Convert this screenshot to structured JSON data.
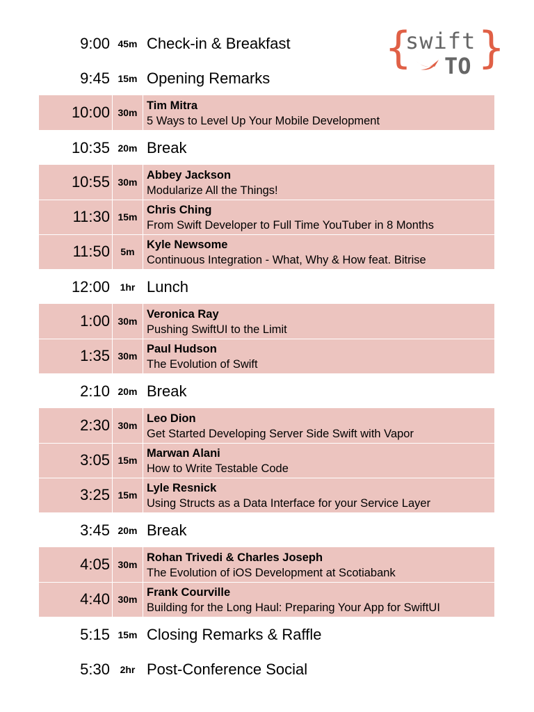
{
  "logo": {
    "word": "swift",
    "suffix": "TO",
    "accent_color": "#e06046",
    "icon": "swift-bird-icon"
  },
  "schedule": [
    {
      "time": "9:00",
      "duration": "45m",
      "event": "Check-in & Breakfast"
    },
    {
      "time": "9:45",
      "duration": "15m",
      "event": "Opening Remarks"
    },
    {
      "time": "10:00",
      "duration": "30m",
      "speaker": "Tim Mitra",
      "title": "5 Ways to Level Up Your Mobile Development"
    },
    {
      "time": "10:35",
      "duration": "20m",
      "event": "Break"
    },
    {
      "time": "10:55",
      "duration": "30m",
      "speaker": "Abbey Jackson",
      "title": "Modularize All the Things!"
    },
    {
      "time": "11:30",
      "duration": "15m",
      "speaker": "Chris Ching",
      "title": "From Swift Developer to Full Time YouTuber in 8 Months"
    },
    {
      "time": "11:50",
      "duration": "5m",
      "speaker": "Kyle Newsome",
      "title": "Continuous Integration - What, Why & How feat. Bitrise"
    },
    {
      "time": "12:00",
      "duration": "1hr",
      "event": "Lunch"
    },
    {
      "time": "1:00",
      "duration": "30m",
      "speaker": "Veronica Ray",
      "title": "Pushing SwiftUI to the Limit"
    },
    {
      "time": "1:35",
      "duration": "30m",
      "speaker": "Paul Hudson",
      "title": "The Evolution of Swift"
    },
    {
      "time": "2:10",
      "duration": "20m",
      "event": "Break"
    },
    {
      "time": "2:30",
      "duration": "30m",
      "speaker": "Leo Dion",
      "title": "Get Started Developing Server Side Swift with Vapor"
    },
    {
      "time": "3:05",
      "duration": "15m",
      "speaker": "Marwan Alani",
      "title": "How to Write Testable Code"
    },
    {
      "time": "3:25",
      "duration": "15m",
      "speaker": "Lyle Resnick",
      "title": "Using Structs as a Data Interface for your Service Layer"
    },
    {
      "time": "3:45",
      "duration": "20m",
      "event": "Break"
    },
    {
      "time": "4:05",
      "duration": "30m",
      "speaker": "Rohan Trivedi & Charles Joseph",
      "title": "The Evolution of iOS Development at Scotiabank"
    },
    {
      "time": "4:40",
      "duration": "30m",
      "speaker": "Frank Courville",
      "title": "Building for the Long Haul: Preparing Your App for SwiftUI"
    },
    {
      "time": "5:15",
      "duration": "15m",
      "event": "Closing Remarks & Raffle"
    },
    {
      "time": "5:30",
      "duration": "2hr",
      "event": "Post-Conference Social"
    }
  ],
  "colors": {
    "talk_background": "#ecc4bf",
    "page_background": "#ffffff"
  }
}
